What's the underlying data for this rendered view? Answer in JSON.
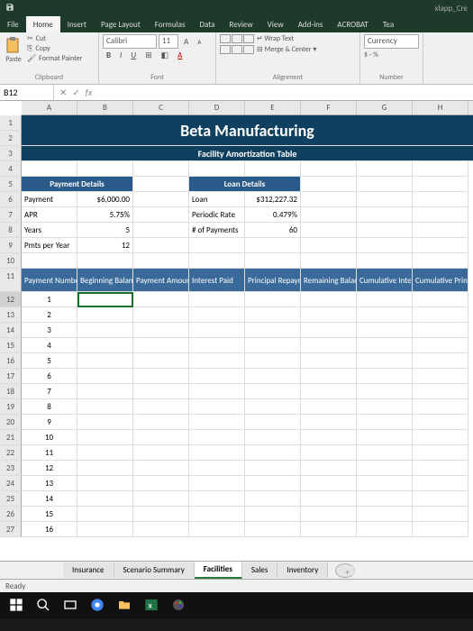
{
  "title_right": "xlapp_Cre",
  "menu": {
    "file": "File",
    "home": "Home",
    "insert": "Insert",
    "page": "Page Layout",
    "formulas": "Formulas",
    "data": "Data",
    "review": "Review",
    "view": "View",
    "addins": "Add-ins",
    "acrobat": "ACROBAT",
    "tea": "Tea"
  },
  "ribbon": {
    "clipboard": {
      "paste": "Paste",
      "cut": "Cut",
      "copy": "Copy",
      "fmt": "Format Painter",
      "label": "Clipboard"
    },
    "font": {
      "name": "Calibri",
      "size": "11",
      "label": "Font"
    },
    "alignment": {
      "wrap": "Wrap Text",
      "merge": "Merge & Center",
      "label": "Alignment"
    },
    "number": {
      "fmt": "Currency",
      "sym": "$ - %",
      "label": "Number"
    }
  },
  "cellref": "B12",
  "cols": [
    "A",
    "B",
    "C",
    "D",
    "E",
    "F",
    "G",
    "H"
  ],
  "sheet_title": "Beta Manufacturing",
  "sheet_subtitle": "Facility Amortization Table",
  "payment_details": {
    "hdr": "Payment Details",
    "r1": {
      "l": "Payment",
      "v": "$6,000.00"
    },
    "r2": {
      "l": "APR",
      "v": "5.75%"
    },
    "r3": {
      "l": "Years",
      "v": "5"
    },
    "r4": {
      "l": "Pmts per Year",
      "v": "12"
    }
  },
  "loan_details": {
    "hdr": "Loan Details",
    "r1": {
      "l": "Loan",
      "v": "$312,227.32"
    },
    "r2": {
      "l": "Periodic Rate",
      "v": "0.479%"
    },
    "r3": {
      "l": "# of Payments",
      "v": "60"
    }
  },
  "table_hdr": {
    "c1": "Payment Number",
    "c2": "Beginning Balance",
    "c3": "Payment Amount",
    "c4": "Interest Paid",
    "c5": "Principal Repayment",
    "c6": "Remaining Balance",
    "c7": "Cumulative Interest",
    "c8": "Cumulative Principal"
  },
  "rows": [
    "1",
    "2",
    "3",
    "4",
    "5",
    "6",
    "7",
    "8",
    "9",
    "10",
    "11",
    "12",
    "13",
    "14",
    "15",
    "16"
  ],
  "tabs": {
    "t1": "Insurance",
    "t2": "Scenario Summary",
    "t3": "Facilities",
    "t4": "Sales",
    "t5": "Inventory"
  },
  "status": "Ready"
}
